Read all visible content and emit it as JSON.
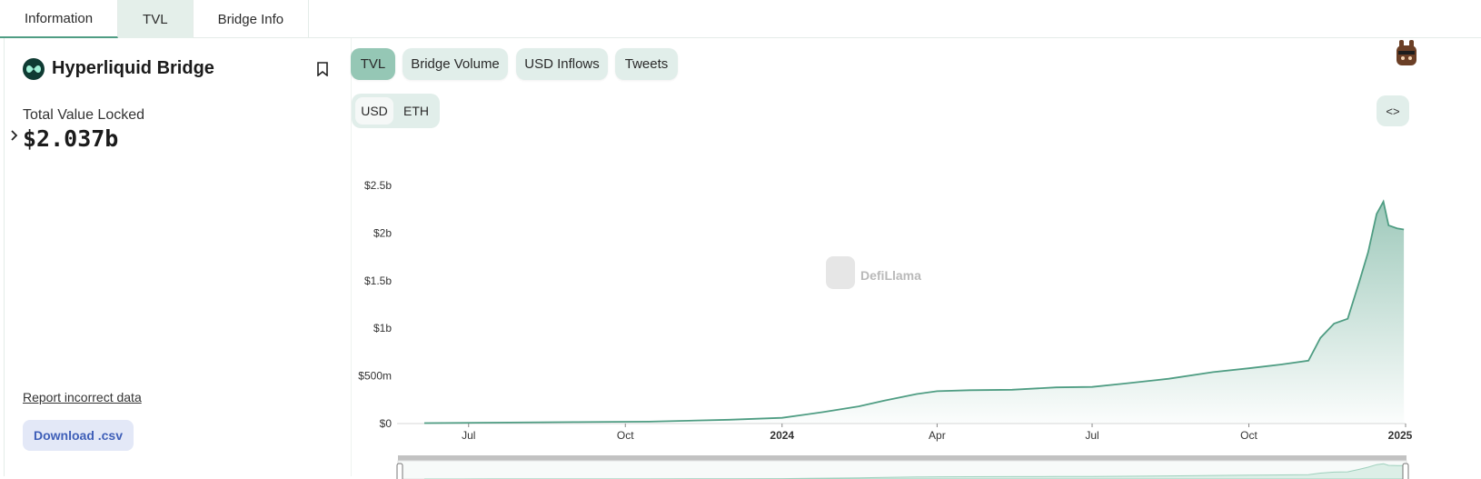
{
  "tabs": [
    {
      "label": "Information"
    },
    {
      "label": "TVL"
    },
    {
      "label": "Bridge Info"
    }
  ],
  "bridge": {
    "name": "Hyperliquid Bridge",
    "tvl_label": "Total Value Locked",
    "tvl_value": "$2.037b",
    "report_link": "Report incorrect data",
    "download_label": "Download .csv"
  },
  "chart_tabs": [
    {
      "label": "TVL",
      "active": true
    },
    {
      "label": "Bridge Volume",
      "active": false
    },
    {
      "label": "USD Inflows",
      "active": false
    },
    {
      "label": "Tweets",
      "active": false
    }
  ],
  "denomination": {
    "options": [
      "USD",
      "ETH"
    ],
    "selected": "USD"
  },
  "embed_icon": "code-brackets-icon",
  "watermark": "DefiLlama",
  "colors": {
    "accent": "#4f9d83",
    "active_pill": "#95c7b5",
    "pill": "#e1eeea",
    "download_bg": "#e3e8f7",
    "download_text": "#3f5fb8"
  },
  "chart_data": {
    "type": "area",
    "title": "",
    "xlabel": "",
    "ylabel": "",
    "y_ticks": [
      "$0",
      "$500m",
      "$1b",
      "$1.5b",
      "$2b",
      "$2.5b"
    ],
    "x_ticks": [
      "Jul",
      "Oct",
      "2024",
      "Apr",
      "Jul",
      "Oct",
      "2025"
    ],
    "x_ticks_bold": [
      false,
      false,
      true,
      false,
      false,
      false,
      true
    ],
    "ylim": [
      0,
      2500000000
    ],
    "grid": false,
    "series": [
      {
        "x": [
          "2023-06-05",
          "2023-07-15",
          "2023-09-01",
          "2023-10-15",
          "2023-12-01",
          "2024-01-01",
          "2024-01-25",
          "2024-02-15",
          "2024-03-01",
          "2024-03-20",
          "2024-04-01",
          "2024-04-20",
          "2024-05-15",
          "2024-06-10",
          "2024-07-01",
          "2024-07-20",
          "2024-08-15",
          "2024-09-10",
          "2024-10-01",
          "2024-10-20",
          "2024-11-05",
          "2024-11-12",
          "2024-11-20",
          "2024-11-28",
          "2024-12-05",
          "2024-12-10",
          "2024-12-15",
          "2024-12-19",
          "2024-12-22",
          "2024-12-27",
          "2024-12-31"
        ],
        "values": [
          5000000,
          10000000,
          15000000,
          20000000,
          40000000,
          60000000,
          120000000,
          180000000,
          240000000,
          310000000,
          340000000,
          350000000,
          355000000,
          380000000,
          385000000,
          420000000,
          470000000,
          540000000,
          580000000,
          620000000,
          660000000,
          900000000,
          1050000000,
          1100000000,
          1500000000,
          1800000000,
          2200000000,
          2330000000,
          2080000000,
          2050000000,
          2037000000
        ]
      }
    ]
  }
}
